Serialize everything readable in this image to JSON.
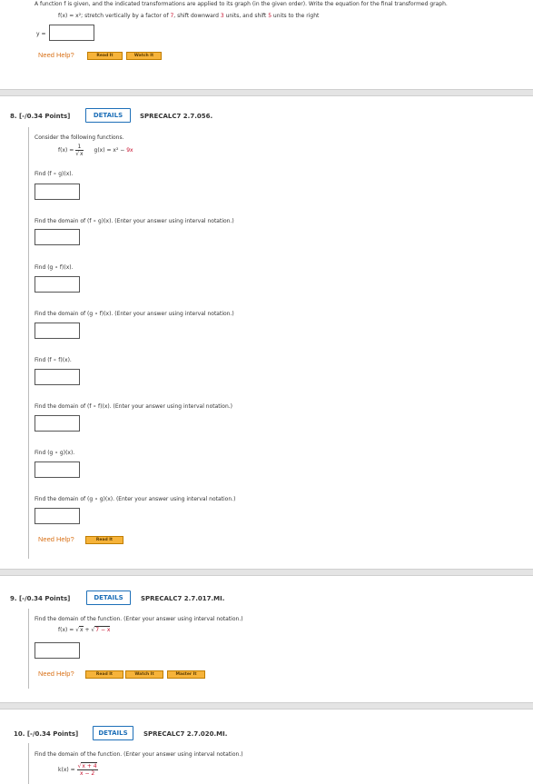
{
  "top": {
    "line1": "A function f is given, and the indicated transformations are applied to its graph (in the given order). Write the equation for the final transformed graph.",
    "line2_fx": "f(x) = x²;",
    "line2_text_a": " stretch vertically by a factor of ",
    "line2_factor": "7",
    "line2_text_b": ", shift downward ",
    "line2_down": "3",
    "line2_text_c": " units, and shift ",
    "line2_right": "5",
    "line2_text_d": " units to the right",
    "y_label": "y =",
    "need_help": "Need Help?",
    "read_it": "Read It",
    "watch_it": "Watch It"
  },
  "q8": {
    "label": "8.  [-/0.34 Points]",
    "details": "DETAILS",
    "code": "SPRECALC7 2.7.056.",
    "intro": "Consider the following functions.",
    "f_lhs": "f(x) =",
    "f_num": "1",
    "f_den": "x",
    "g_lhs": "g(x) =",
    "g_rhs_a": "x² − ",
    "g_rhs_b": "9x",
    "prompts": [
      "Find  (f ∘ g)(x).",
      "Find the domain of  (f ∘ g)(x).  (Enter your answer using interval notation.)",
      "Find  (g ∘ f)(x).",
      "Find the domain of  (g ∘ f)(x).  (Enter your answer using interval notation.)",
      "Find  (f ∘ f)(x).",
      "Find the domain of  (f ∘ f)(x).  (Enter your answer using interval notation.)",
      "Find  (g ∘ g)(x).",
      "Find the domain of  (g ∘ g)(x).  (Enter your answer using interval notation.)"
    ],
    "need_help": "Need Help?",
    "read_it": "Read It"
  },
  "q9": {
    "label": "9.  [-/0.34 Points]",
    "details": "DETAILS",
    "code": "SPRECALC7 2.7.017.MI.",
    "prompt": "Find the domain of the function. (Enter your answer using interval notation.)",
    "f_lhs": "f(x) =",
    "f_a": "x",
    "f_plus": " + ",
    "f_b": "7 − x",
    "need_help": "Need Help?",
    "read_it": "Read It",
    "watch_it": "Watch It",
    "master_it": "Master It"
  },
  "q10": {
    "label": "10.  [-/0.34 Points]",
    "details": "DETAILS",
    "code": "SPRECALC7 2.7.020.MI.",
    "prompt": "Find the domain of the function. (Enter your answer using interval notation.)",
    "k_lhs": "k(x) =",
    "k_num": "x + 4",
    "k_den": "x − 2"
  },
  "colors": {
    "accent": "#1d6fb8",
    "help": "#d9731b",
    "button": "#f6b33a",
    "highlight": "#c8102e"
  }
}
